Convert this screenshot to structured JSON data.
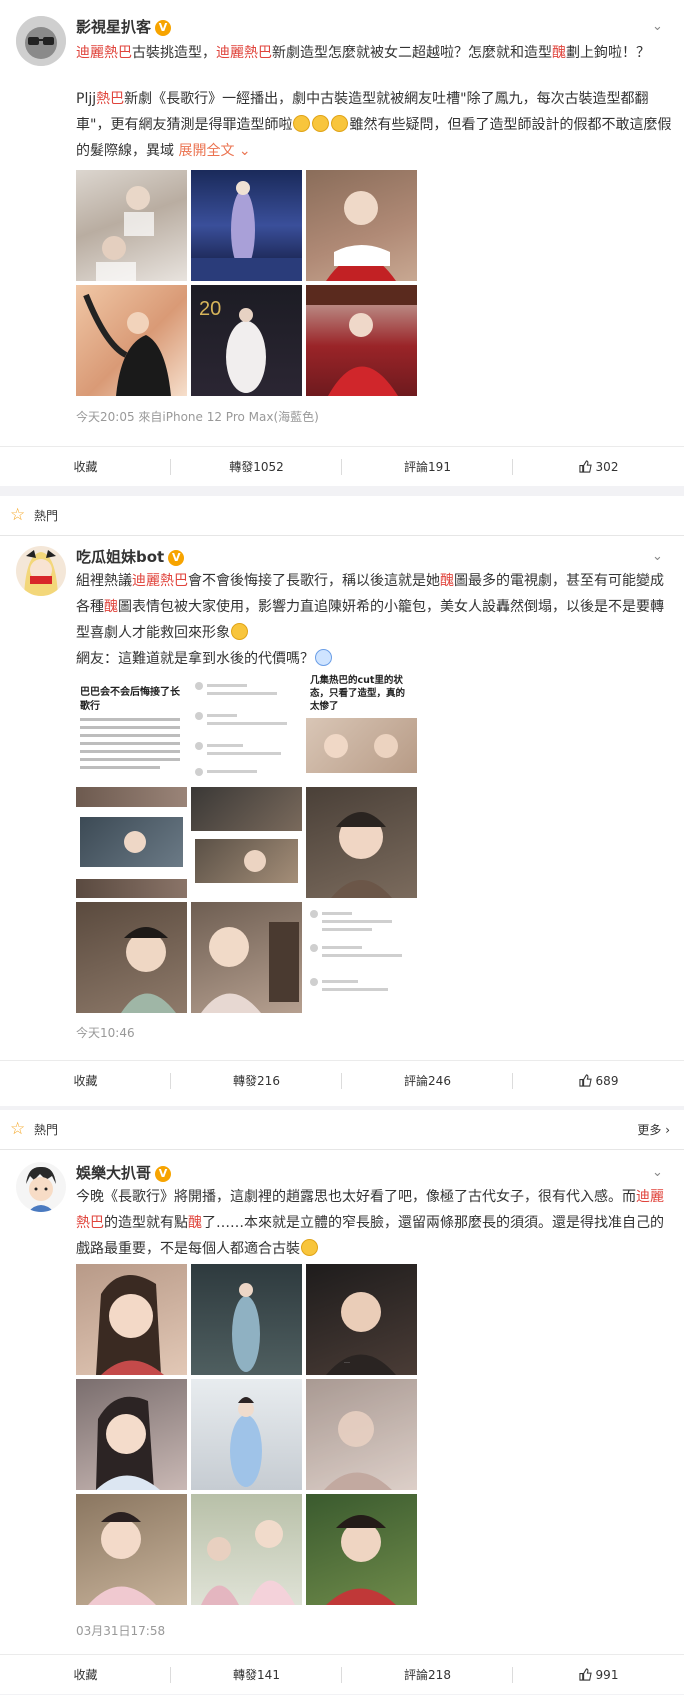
{
  "posts": [
    {
      "username": "影視星扒客",
      "verified": "V",
      "text": {
        "p1": [
          {
            "t": "迪麗熱巴",
            "hl": true
          },
          {
            "t": "古裝挑造型，",
            "hl": false
          },
          {
            "t": "迪麗熱巴",
            "hl": true
          },
          {
            "t": "新劇造型怎麼就被女二超越啦？怎麼就和造型",
            "hl": false
          },
          {
            "t": "醜",
            "hl": true
          },
          {
            "t": "劃上鉤啦！？",
            "hl": false
          }
        ],
        "p2": [
          {
            "t": "Pljj",
            "hl": false
          },
          {
            "t": "熱巴",
            "hl": true
          },
          {
            "t": "新劇《長歌行》一經播出，劇中古裝造型就被網友吐槽\"除了鳳九，每次古裝造型都翻車\"，更有網友猜測是得罪造型師啦",
            "hl": false
          }
        ],
        "p2_tail": "雖然有些疑問，但看了造型師設計的假都不敢這麼假的髮際線，異域",
        "expand": "展開全文"
      },
      "meta": "今天20:05  來自iPhone 12 Pro Max(海藍色)",
      "actions": {
        "fav": "收藏",
        "repost": "轉發1052",
        "comment": "評論191",
        "like": "302"
      }
    },
    {
      "username": "吃瓜姐妹bot",
      "verified": "V",
      "text": {
        "p1": [
          {
            "t": "組裡熱議",
            "hl": false
          },
          {
            "t": "迪麗熱巴",
            "hl": true
          },
          {
            "t": "會不會後悔接了長歌行，稱以後這就是她",
            "hl": false
          },
          {
            "t": "醜",
            "hl": true
          },
          {
            "t": "圖最多的電視劇，甚至有可能變成各種",
            "hl": false
          },
          {
            "t": "醜",
            "hl": true
          },
          {
            "t": "圖表情包被大家使用，影響力直追陳妍希的小籠包，美女人設轟然倒塌，以後是不是要轉型喜劇人才能救回來形象",
            "hl": false
          }
        ],
        "p2": "網友：這難道就是拿到水後的代價嗎？"
      },
      "screens": {
        "s1_title": "巴巴会不会后悔接了长歌行",
        "s3_title": "几集热巴的cut里的状态，只看了造型，真的太惨了"
      },
      "meta": "今天10:46",
      "actions": {
        "fav": "收藏",
        "repost": "轉發216",
        "comment": "評論246",
        "like": "689"
      }
    },
    {
      "username": "娛樂大扒哥",
      "verified": "V",
      "text": {
        "p1": [
          {
            "t": "今晚《長歌行》將開播，這劇裡的趙露思也太好看了吧，像極了古代女子，很有代入感。而",
            "hl": false
          },
          {
            "t": "迪麗熱巴",
            "hl": true
          },
          {
            "t": "的造型就有點",
            "hl": false
          },
          {
            "t": "醜",
            "hl": true
          },
          {
            "t": "了……本來就是立體的窄長臉，還留兩條那麼長的須須。還是得找准自己的戲路最重要，不是每個人都適合古裝",
            "hl": false
          }
        ]
      },
      "meta": "03月31日17:58",
      "actions": {
        "fav": "收藏",
        "repost": "轉發141",
        "comment": "評論218",
        "like": "991"
      }
    }
  ],
  "hot_label": "熱門",
  "more_label": "更多",
  "colors": {
    "highlight": "#e0443c",
    "link": "#eb7350",
    "background": "#f2f2f5",
    "badge": "#f7a400"
  }
}
